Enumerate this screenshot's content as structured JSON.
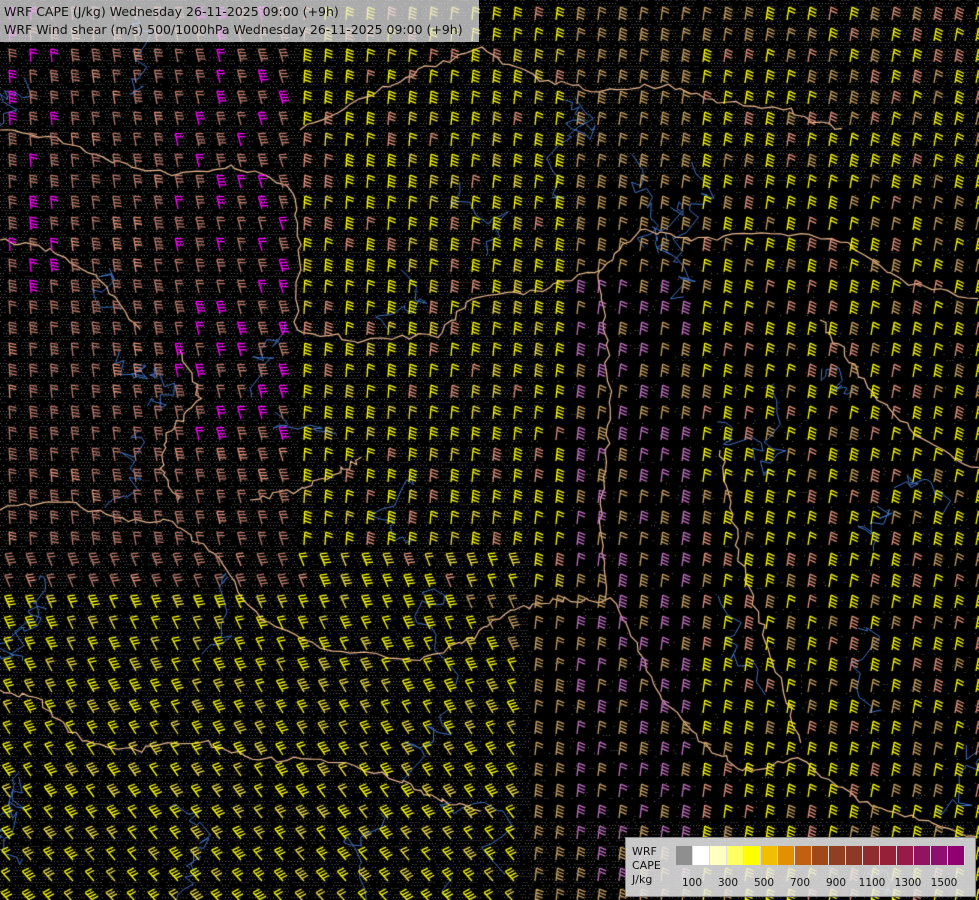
{
  "title": {
    "line1": "WRF CAPE (J/kg) Wednesday 26-11-2025 09:00 (+9h)",
    "line2": "WRF Wind shear (m/s) 500/1000hPa Wednesday 26-11-2025 09:00 (+9h)"
  },
  "legend": {
    "model": "WRF",
    "field": "CAPE",
    "unit": "J/kg",
    "colors": [
      "#8f8f8f",
      "#ffffff",
      "#ffffc0",
      "#ffff60",
      "#ffff00",
      "#f0c000",
      "#e09000",
      "#c06010",
      "#a04818",
      "#904020",
      "#8e3828",
      "#902c30",
      "#962038",
      "#981a48",
      "#921460",
      "#900e70",
      "#900070"
    ],
    "ticks": [
      "100",
      "300",
      "500",
      "700",
      "900",
      "1100",
      "1300",
      "1500"
    ]
  },
  "map": {
    "barb_colors": [
      "#ffff00",
      "#f0e040",
      "#c8a060",
      "#e0907a",
      "#b8786a",
      "#ff00ff",
      "#c070c0",
      "#ff6080",
      "#a07090"
    ],
    "border_color": "#e8b890",
    "river_color": "#4070c0",
    "terrain_dot_color": "#606060"
  }
}
